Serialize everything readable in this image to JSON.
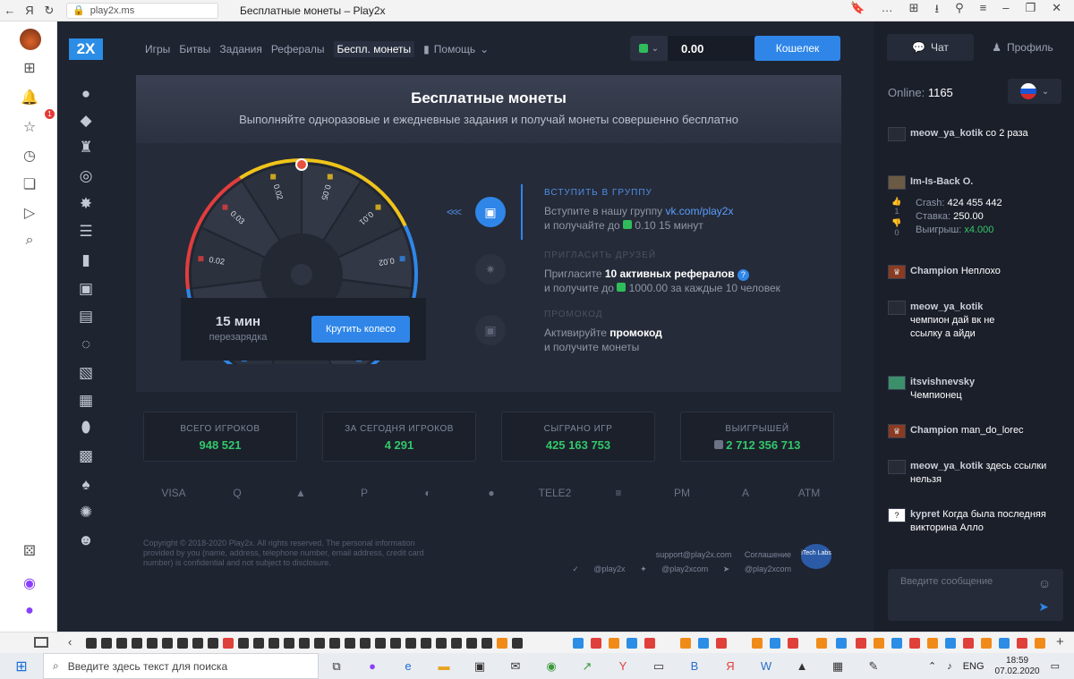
{
  "browser": {
    "url": "play2x.ms",
    "tab_title": "Бесплатные монеты – Play2x",
    "back_icon": "←",
    "yandex_glyph": "Я",
    "reload_icon": "↻",
    "lock_icon": "🔒",
    "notification_count": "1"
  },
  "site": {
    "logo": "2X",
    "nav": [
      "Игры",
      "Битвы",
      "Задания",
      "Рефералы",
      "Беспл. монеты"
    ],
    "help": "Помощь",
    "balance": "0.00",
    "wallet_button": "Кошелек",
    "colors": {
      "accent": "#2f86e8",
      "green": "#33c76a",
      "background": "#1f2431"
    }
  },
  "free_coins": {
    "title": "Бесплатные монеты",
    "subtitle": "Выполняйте одноразовые и ежедневные задания и получай монеты совершенно бесплатно",
    "wheel_values": [
      "0.01",
      "0.01",
      "0.02",
      "0.03",
      "0.02",
      "0.05",
      "0.01",
      "0.02",
      "0.01",
      "0.01"
    ],
    "cooldown_value": "15 мин",
    "cooldown_label": "перезарядка",
    "spin_button": "Крутить колесо",
    "arrows": "<<<",
    "steps": [
      {
        "title": "вступить в группу",
        "text_1": "Вступите в нашу группу",
        "link": "vk.com/play2x",
        "text_2": "и получайте до",
        "amount": "0.10 15 минут"
      },
      {
        "title": "пригласить друзей",
        "text_1": "Пригласите",
        "bold": "10 активных рефералов",
        "text_2": "и получите до",
        "amount": "1000.00 за каждые 10 человек"
      },
      {
        "title": "промокод",
        "text_1": "Активируйте",
        "bold": "промокод",
        "text_2": "и получите монеты"
      }
    ]
  },
  "stats": [
    {
      "label": "ВСЕГО ИГРОКОВ",
      "value": "948 521"
    },
    {
      "label": "ЗА СЕГОДНЯ ИГРОКОВ",
      "value": "4 291"
    },
    {
      "label": "СЫГРАНО ИГР",
      "value": "425 163 753"
    },
    {
      "label": "ВЫИГРЫШЕЙ",
      "value": "2 712 356 713"
    }
  ],
  "payments": [
    "VISA",
    "Q",
    "▲",
    "P",
    "◐",
    "●",
    "TELE2",
    "≡",
    "PM",
    "A",
    "ATM"
  ],
  "footer": {
    "copyright": "Copyright © 2018-2020 Play2x. All rights reserved. The personal information provided by you (name, address, telephone number, email address, credit card number) is confidential and not subject to disclosure.",
    "support": "support@play2x.com",
    "agreement": "Соглашение",
    "social_vk": "@play2x",
    "social_twitter": "@play2xcom",
    "social_telegram": "@play2xcom",
    "itech": "iTech Labs"
  },
  "chat": {
    "tab_chat": "Чат",
    "tab_profile": "Профиль",
    "online_label": "Online:",
    "online_count": "1165",
    "messages": [
      {
        "nick": "meow_ya_kotik",
        "text": "со 2 раза"
      },
      {
        "nick": "Im-Is-Back O.",
        "text": ""
      },
      {
        "nick": "Champion",
        "text": "Неплохо"
      },
      {
        "nick": "meow_ya_kotik",
        "text": "чемпион дай вк не ссылку а айди"
      },
      {
        "nick": "itsvishnevsky",
        "text": "Чемпионец"
      },
      {
        "nick": "Champion",
        "text": "man_do_lorec"
      },
      {
        "nick": "meow_ya_kotik",
        "text": "здесь ссылки нельзя"
      },
      {
        "nick": "kypret",
        "text": "Когда была последняя викторина Алло"
      }
    ],
    "bet": {
      "crash_label": "Crash:",
      "crash_value": "424 455 442",
      "bet_label": "Ставка:",
      "bet_value": "250.00",
      "win_label": "Выигрыш:",
      "win_value": "x4.000",
      "votes_up": "1",
      "votes_down": "0"
    },
    "input_placeholder": "Введите сообщение"
  },
  "taskbar": {
    "search_placeholder": "Введите здесь текст для поиска",
    "lang": "ENG",
    "time": "18:59",
    "date": "07.02.2020"
  }
}
